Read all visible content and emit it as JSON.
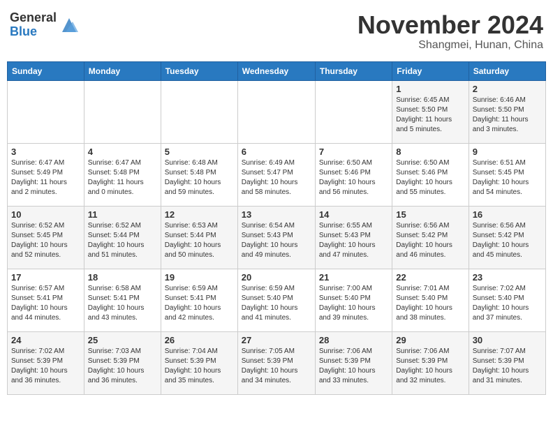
{
  "header": {
    "logo_general": "General",
    "logo_blue": "Blue",
    "month_title": "November 2024",
    "subtitle": "Shangmei, Hunan, China"
  },
  "days_of_week": [
    "Sunday",
    "Monday",
    "Tuesday",
    "Wednesday",
    "Thursday",
    "Friday",
    "Saturday"
  ],
  "weeks": [
    [
      {
        "day": "",
        "info": ""
      },
      {
        "day": "",
        "info": ""
      },
      {
        "day": "",
        "info": ""
      },
      {
        "day": "",
        "info": ""
      },
      {
        "day": "",
        "info": ""
      },
      {
        "day": "1",
        "info": "Sunrise: 6:45 AM\nSunset: 5:50 PM\nDaylight: 11 hours\nand 5 minutes."
      },
      {
        "day": "2",
        "info": "Sunrise: 6:46 AM\nSunset: 5:50 PM\nDaylight: 11 hours\nand 3 minutes."
      }
    ],
    [
      {
        "day": "3",
        "info": "Sunrise: 6:47 AM\nSunset: 5:49 PM\nDaylight: 11 hours\nand 2 minutes."
      },
      {
        "day": "4",
        "info": "Sunrise: 6:47 AM\nSunset: 5:48 PM\nDaylight: 11 hours\nand 0 minutes."
      },
      {
        "day": "5",
        "info": "Sunrise: 6:48 AM\nSunset: 5:48 PM\nDaylight: 10 hours\nand 59 minutes."
      },
      {
        "day": "6",
        "info": "Sunrise: 6:49 AM\nSunset: 5:47 PM\nDaylight: 10 hours\nand 58 minutes."
      },
      {
        "day": "7",
        "info": "Sunrise: 6:50 AM\nSunset: 5:46 PM\nDaylight: 10 hours\nand 56 minutes."
      },
      {
        "day": "8",
        "info": "Sunrise: 6:50 AM\nSunset: 5:46 PM\nDaylight: 10 hours\nand 55 minutes."
      },
      {
        "day": "9",
        "info": "Sunrise: 6:51 AM\nSunset: 5:45 PM\nDaylight: 10 hours\nand 54 minutes."
      }
    ],
    [
      {
        "day": "10",
        "info": "Sunrise: 6:52 AM\nSunset: 5:45 PM\nDaylight: 10 hours\nand 52 minutes."
      },
      {
        "day": "11",
        "info": "Sunrise: 6:52 AM\nSunset: 5:44 PM\nDaylight: 10 hours\nand 51 minutes."
      },
      {
        "day": "12",
        "info": "Sunrise: 6:53 AM\nSunset: 5:44 PM\nDaylight: 10 hours\nand 50 minutes."
      },
      {
        "day": "13",
        "info": "Sunrise: 6:54 AM\nSunset: 5:43 PM\nDaylight: 10 hours\nand 49 minutes."
      },
      {
        "day": "14",
        "info": "Sunrise: 6:55 AM\nSunset: 5:43 PM\nDaylight: 10 hours\nand 47 minutes."
      },
      {
        "day": "15",
        "info": "Sunrise: 6:56 AM\nSunset: 5:42 PM\nDaylight: 10 hours\nand 46 minutes."
      },
      {
        "day": "16",
        "info": "Sunrise: 6:56 AM\nSunset: 5:42 PM\nDaylight: 10 hours\nand 45 minutes."
      }
    ],
    [
      {
        "day": "17",
        "info": "Sunrise: 6:57 AM\nSunset: 5:41 PM\nDaylight: 10 hours\nand 44 minutes."
      },
      {
        "day": "18",
        "info": "Sunrise: 6:58 AM\nSunset: 5:41 PM\nDaylight: 10 hours\nand 43 minutes."
      },
      {
        "day": "19",
        "info": "Sunrise: 6:59 AM\nSunset: 5:41 PM\nDaylight: 10 hours\nand 42 minutes."
      },
      {
        "day": "20",
        "info": "Sunrise: 6:59 AM\nSunset: 5:40 PM\nDaylight: 10 hours\nand 41 minutes."
      },
      {
        "day": "21",
        "info": "Sunrise: 7:00 AM\nSunset: 5:40 PM\nDaylight: 10 hours\nand 39 minutes."
      },
      {
        "day": "22",
        "info": "Sunrise: 7:01 AM\nSunset: 5:40 PM\nDaylight: 10 hours\nand 38 minutes."
      },
      {
        "day": "23",
        "info": "Sunrise: 7:02 AM\nSunset: 5:40 PM\nDaylight: 10 hours\nand 37 minutes."
      }
    ],
    [
      {
        "day": "24",
        "info": "Sunrise: 7:02 AM\nSunset: 5:39 PM\nDaylight: 10 hours\nand 36 minutes."
      },
      {
        "day": "25",
        "info": "Sunrise: 7:03 AM\nSunset: 5:39 PM\nDaylight: 10 hours\nand 36 minutes."
      },
      {
        "day": "26",
        "info": "Sunrise: 7:04 AM\nSunset: 5:39 PM\nDaylight: 10 hours\nand 35 minutes."
      },
      {
        "day": "27",
        "info": "Sunrise: 7:05 AM\nSunset: 5:39 PM\nDaylight: 10 hours\nand 34 minutes."
      },
      {
        "day": "28",
        "info": "Sunrise: 7:06 AM\nSunset: 5:39 PM\nDaylight: 10 hours\nand 33 minutes."
      },
      {
        "day": "29",
        "info": "Sunrise: 7:06 AM\nSunset: 5:39 PM\nDaylight: 10 hours\nand 32 minutes."
      },
      {
        "day": "30",
        "info": "Sunrise: 7:07 AM\nSunset: 5:39 PM\nDaylight: 10 hours\nand 31 minutes."
      }
    ]
  ]
}
